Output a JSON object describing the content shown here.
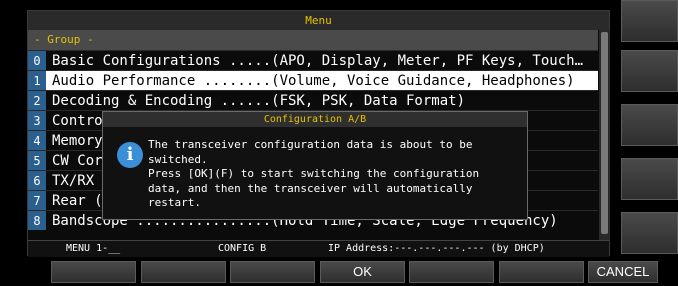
{
  "menu": {
    "title": "Menu",
    "group_label": "- Group -",
    "items": [
      {
        "num": "0",
        "text": "Basic Configurations .....(APO, Display, Meter, PF Keys, Touch…"
      },
      {
        "num": "1",
        "text": "Audio Performance ........(Volume, Voice Guidance, Headphones)"
      },
      {
        "num": "2",
        "text": "Decoding & Encoding ......(FSK, PSK, Data Format)"
      },
      {
        "num": "3",
        "text": "Contro                                                 neous)"
      },
      {
        "num": "4",
        "text": "Memory                                                 el)"
      },
      {
        "num": "5",
        "text": "CW Cor                                                 iscell…"
      },
      {
        "num": "6",
        "text": "TX/RX                                                  Inhibi…"
      },
      {
        "num": "7",
        "text": "Rear (                                                 acketC…"
      },
      {
        "num": "8",
        "text": "Bandscope ................(Hold Time, Scale, Edge Frequency)"
      }
    ]
  },
  "status": {
    "menu_indicator": "MENU 1-__",
    "config": "CONFIG B",
    "ip": "IP Address:---.---.---.--- (by DHCP)"
  },
  "dialog": {
    "title": "Configuration A/B",
    "icon": "info-icon",
    "line1": "The transceiver configuration data is about to be",
    "line2": "switched.",
    "line3": "Press [OK](F) to start switching the configuration",
    "line4": "data, and then the transceiver will automatically",
    "line5": "restart."
  },
  "softkeys": {
    "k1": "",
    "k2": "",
    "k3": "",
    "k4": "OK",
    "k5": "",
    "k6": "",
    "k7": "CANCEL"
  },
  "colors": {
    "accent_yellow": "#e6c200",
    "number_blue": "#2a5f8e",
    "info_blue": "#3a8fd6"
  }
}
